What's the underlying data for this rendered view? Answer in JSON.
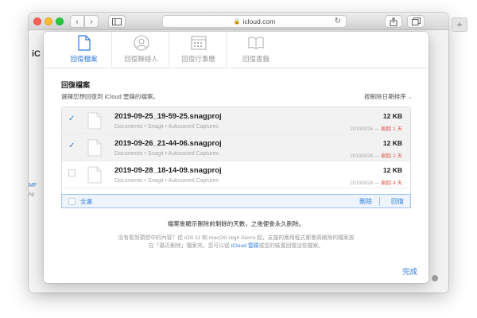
{
  "browser": {
    "url": "icloud.com"
  },
  "background": {
    "app_initials": "iC",
    "left_text_1": "MF",
    "left_text_2": "Ap"
  },
  "dialog": {
    "tabs": [
      {
        "label": "回復檔案",
        "icon": "document-icon",
        "active": true
      },
      {
        "label": "回復聯絡人",
        "icon": "contacts-icon",
        "active": false
      },
      {
        "label": "回復行事曆",
        "icon": "calendar-icon",
        "active": false
      },
      {
        "label": "回復書籤",
        "icon": "book-icon",
        "active": false
      }
    ],
    "section_title": "回復檔案",
    "section_subtitle": "選擇您想回復到 iCloud 雲碟的檔案。",
    "sort_label": "按刪除日期排序",
    "files": [
      {
        "name": "2019-09-25_19-59-25.snagproj",
        "path": "Documents • Snagit • Autosaved Captures",
        "size": "12 KB",
        "date": "2019/9/26 —",
        "days": "剩餘 1 天",
        "checked": true
      },
      {
        "name": "2019-09-26_21-44-06.snagproj",
        "path": "Documents • Snagit • Autosaved Captures",
        "size": "12 KB",
        "date": "2019/9/26 —",
        "days": "剩餘 2 天",
        "checked": true
      },
      {
        "name": "2019-09-28_18-14-09.snagproj",
        "path": "Documents • Snagit • Autosaved Captures",
        "size": "12 KB",
        "date": "2019/9/28 —",
        "days": "剩餘 4 天",
        "checked": false
      }
    ],
    "select_all": "全選",
    "delete": "刪除",
    "restore": "回復",
    "notice": "檔案會顯示刪除前剩餘的天數，之後便會永久刪除。",
    "help_line1": "沒有看到預想中的內容？從 iOS 11 和 macOS High Sierra 起，支援的應用程式都會將刪除的檔案放",
    "help_line2_a": "在「最近刪除」檔案夾。您可以從",
    "help_line2_link": "iCloud 雲碟",
    "help_line2_b": "或您的裝置回復這些檔案。",
    "done": "完成"
  },
  "colors": {
    "accent": "#2f7bd8",
    "days_remaining": "#e4584f"
  }
}
